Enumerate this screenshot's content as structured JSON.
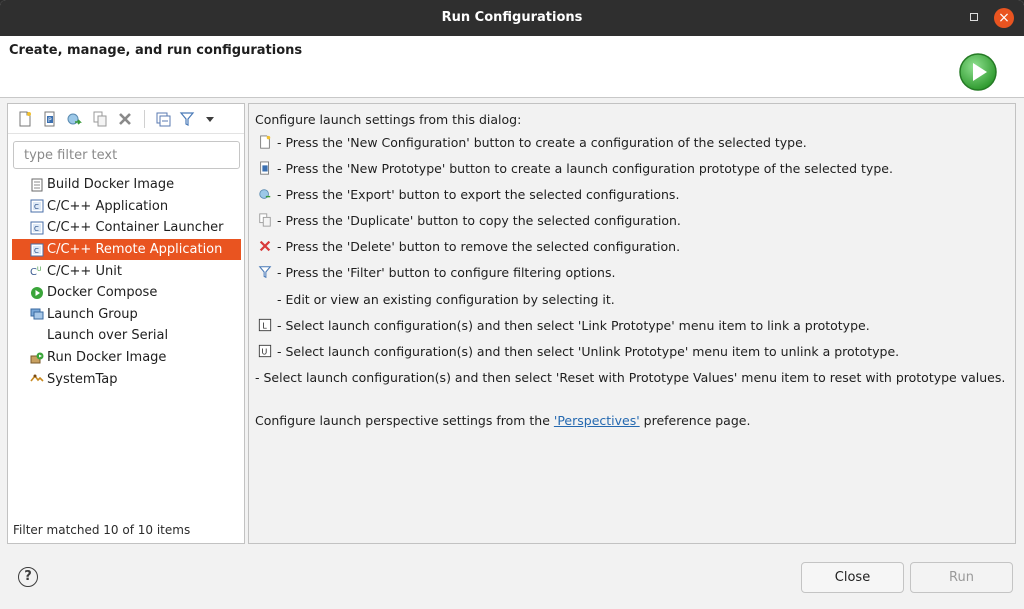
{
  "window": {
    "title": "Run Configurations"
  },
  "header": {
    "title": "Create, manage, and run configurations"
  },
  "toolbar": {
    "buttons": [
      "new-configuration-icon",
      "new-prototype-icon",
      "export-icon",
      "duplicate-icon",
      "delete-icon",
      "collapse-all-icon",
      "filter-icon",
      "view-menu-icon"
    ]
  },
  "filter": {
    "placeholder": "type filter text",
    "value": ""
  },
  "tree": {
    "items": [
      {
        "label": "Build Docker Image",
        "icon": "docker-build-icon"
      },
      {
        "label": "C/C++ Application",
        "icon": "c-app-icon"
      },
      {
        "label": "C/C++ Container Launcher",
        "icon": "c-app-icon"
      },
      {
        "label": "C/C++ Remote Application",
        "icon": "c-app-icon",
        "selected": true
      },
      {
        "label": "C/C++ Unit",
        "icon": "c-unit-icon"
      },
      {
        "label": "Docker Compose",
        "icon": "docker-compose-icon"
      },
      {
        "label": "Launch Group",
        "icon": "launch-group-icon"
      },
      {
        "label": "Launch over Serial",
        "icon": ""
      },
      {
        "label": "Run Docker Image",
        "icon": "docker-run-icon"
      },
      {
        "label": "SystemTap",
        "icon": "systemtap-icon"
      }
    ],
    "status": "Filter matched 10 of 10 items"
  },
  "help": {
    "intro": "Configure launch settings from this dialog:",
    "lines": [
      "- Press the 'New Configuration' button to create a configuration of the selected type.",
      "- Press the 'New Prototype' button to create a launch configuration prototype of the selected type.",
      "- Press the 'Export' button to export the selected configurations.",
      "- Press the 'Duplicate' button to copy the selected configuration.",
      "- Press the 'Delete' button to remove the selected configuration.",
      "- Press the 'Filter' button to configure filtering options.",
      "- Edit or view an existing configuration by selecting it.",
      "- Select launch configuration(s) and then select 'Link Prototype' menu item to link a prototype.",
      "- Select launch configuration(s) and then select 'Unlink Prototype' menu item to unlink a prototype.",
      "- Select launch configuration(s) and then select 'Reset with Prototype Values' menu item to reset with prototype values."
    ],
    "perspective_prefix": "Configure launch perspective settings from the ",
    "perspective_link": "'Perspectives'",
    "perspective_suffix": " preference page."
  },
  "buttons": {
    "close": "Close",
    "run": "Run",
    "help": "?"
  },
  "colors": {
    "accent": "#e95420",
    "titlebar": "#2f2f2f",
    "link": "#2569b0",
    "run_green": "#3aa53a"
  }
}
